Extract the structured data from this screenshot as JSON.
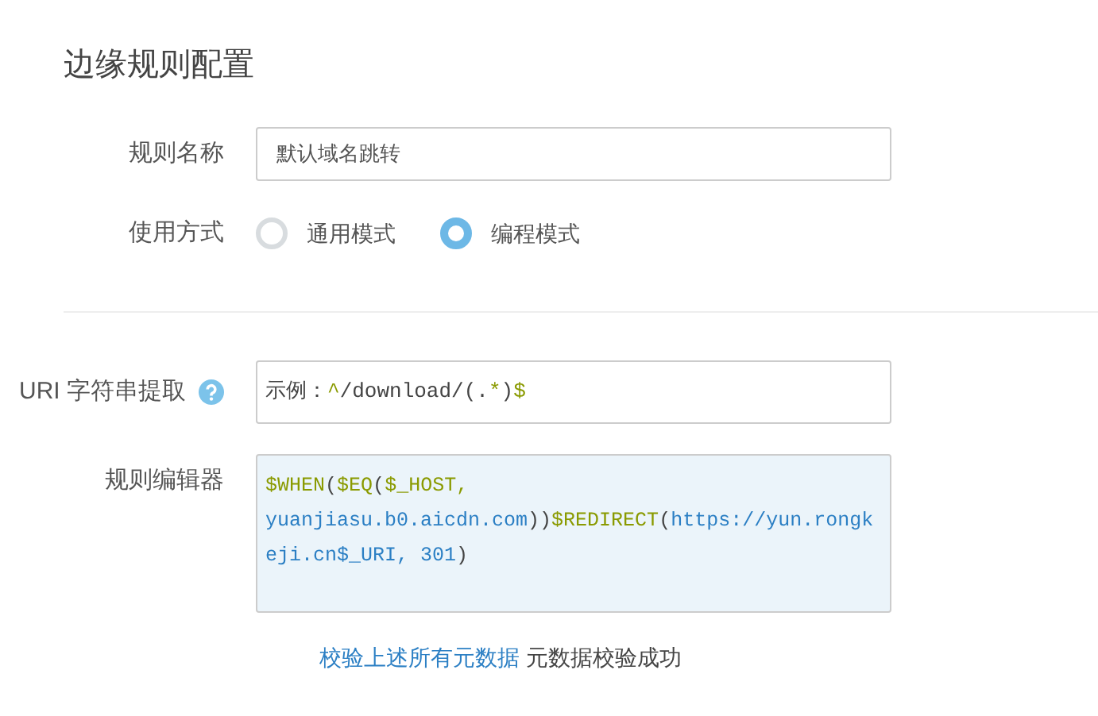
{
  "title": "边缘规则配置",
  "rule_name": {
    "label": "规则名称",
    "value": "默认域名跳转"
  },
  "usage": {
    "label": "使用方式",
    "options": [
      {
        "label": "通用模式",
        "selected": false
      },
      {
        "label": "编程模式",
        "selected": true
      }
    ]
  },
  "uri_extract": {
    "label": "URI 字符串提取",
    "value": [
      {
        "kind": "plain",
        "text": "示例："
      },
      {
        "kind": "func",
        "text": "^"
      },
      {
        "kind": "plain",
        "text": "/download/(."
      },
      {
        "kind": "func",
        "text": "*"
      },
      {
        "kind": "plain",
        "text": ")"
      },
      {
        "kind": "func",
        "text": "$"
      }
    ]
  },
  "rule_editor": {
    "label": "规则编辑器",
    "code": [
      {
        "kind": "func",
        "text": "$WHEN"
      },
      {
        "kind": "plain",
        "text": "("
      },
      {
        "kind": "func",
        "text": "$EQ"
      },
      {
        "kind": "plain",
        "text": "("
      },
      {
        "kind": "func",
        "text": "$_HOST, "
      },
      {
        "kind": "string",
        "text": "yuanjiasu.b0.aicdn.com"
      },
      {
        "kind": "plain",
        "text": "))"
      },
      {
        "kind": "func",
        "text": "$REDIRECT"
      },
      {
        "kind": "plain",
        "text": "("
      },
      {
        "kind": "string",
        "text": "https://yun.rongkeji.cn$_URI, 301"
      },
      {
        "kind": "plain",
        "text": ")"
      }
    ]
  },
  "validate": {
    "link": "校验上述所有元数据",
    "result": "元数据校验成功"
  }
}
